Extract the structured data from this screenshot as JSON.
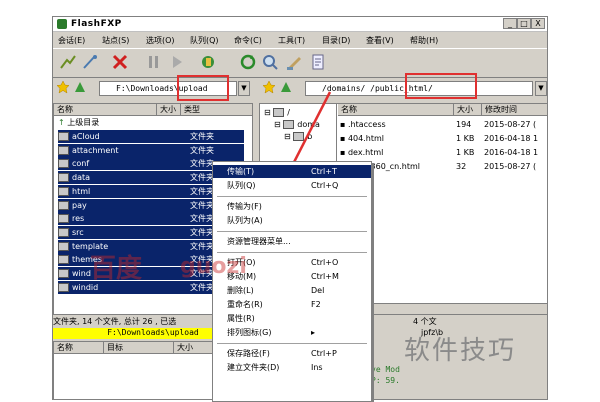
{
  "window": {
    "title": "FlashFXP",
    "minimize": "_",
    "maximize": "□",
    "close": "X"
  },
  "menu": [
    "会话(E)",
    "站点(S)",
    "选项(O)",
    "队列(Q)",
    "命令(C)",
    "工具(T)",
    "目录(D)",
    "查看(V)",
    "帮助(H)"
  ],
  "local": {
    "path": "F:\\Downloads\\upload",
    "columns": {
      "name": "名称",
      "size": "大小",
      "type": "类型"
    },
    "up_label": "上级目录",
    "items": [
      {
        "name": "aCloud",
        "type": "文件夹"
      },
      {
        "name": "attachment",
        "type": "文件夹"
      },
      {
        "name": "conf",
        "type": "文件夹"
      },
      {
        "name": "data",
        "type": "文件夹"
      },
      {
        "name": "html",
        "type": "文件夹"
      },
      {
        "name": "pay",
        "type": "文件夹"
      },
      {
        "name": "res",
        "type": "文件夹"
      },
      {
        "name": "src",
        "type": "文件夹"
      },
      {
        "name": "template",
        "type": "文件夹"
      },
      {
        "name": "themes",
        "type": "文件夹"
      },
      {
        "name": "wind",
        "type": "文件夹"
      },
      {
        "name": "windid",
        "type": "文件夹"
      }
    ],
    "status": "文件夹, 14 个文件, 总计 26 , 已选",
    "status_path": "F:\\Downloads\\upload"
  },
  "remote": {
    "path": "/domains/          /public_html/",
    "tree_root": "/",
    "tree_item1": "doma",
    "tree_item2": "b",
    "columns": {
      "name": "名称",
      "size": "大小",
      "date": "修改时间"
    },
    "items": [
      {
        "name": ".htaccess",
        "size": "194",
        "date": "2015-08-27 ("
      },
      {
        "name": "404.html",
        "size": "1 KB",
        "date": "2016-04-18 1"
      },
      {
        "name": "dex.html",
        "size": "1 KB",
        "date": "2016-04-18 1"
      },
      {
        "name": "scan_360_cn.html",
        "size": "32",
        "date": "2015-08-27 ("
      }
    ],
    "status": "4 个文",
    "status2": "jpfz\\b"
  },
  "queue": {
    "columns": {
      "name": "名称",
      "target": "目标",
      "size": "大小"
    }
  },
  "log": {
    "line1": "ve Mod",
    "line2": "P: 59."
  },
  "context_menu": [
    {
      "label": "传输(T)",
      "key": "Ctrl+T",
      "highlight": true
    },
    {
      "label": "队列(Q)",
      "key": "Ctrl+Q"
    },
    {
      "sep": true
    },
    {
      "label": "传输为(F)",
      "key": ""
    },
    {
      "label": "队列为(A)",
      "key": ""
    },
    {
      "sep": true
    },
    {
      "label": "资源管理器菜单...",
      "key": ""
    },
    {
      "sep": true
    },
    {
      "label": "打开(O)",
      "key": "Ctrl+O"
    },
    {
      "label": "移动(M)",
      "key": "Ctrl+M"
    },
    {
      "label": "删除(L)",
      "key": "Del"
    },
    {
      "label": "重命名(R)",
      "key": "F2"
    },
    {
      "label": "属性(R)",
      "key": ""
    },
    {
      "label": "排列图标(G)",
      "key": "▸"
    },
    {
      "sep": true
    },
    {
      "label": "保存路径(F)",
      "key": "Ctrl+P"
    },
    {
      "label": "建立文件夹(D)",
      "key": "Ins"
    }
  ],
  "watermark": {
    "bottom_right": "软件技巧",
    "overlay1": "百度",
    "overlay2": "guozi"
  },
  "colors": {
    "selection": "#0a246a",
    "annotation_red": "#e03030",
    "status_yellow": "#ffff00"
  }
}
